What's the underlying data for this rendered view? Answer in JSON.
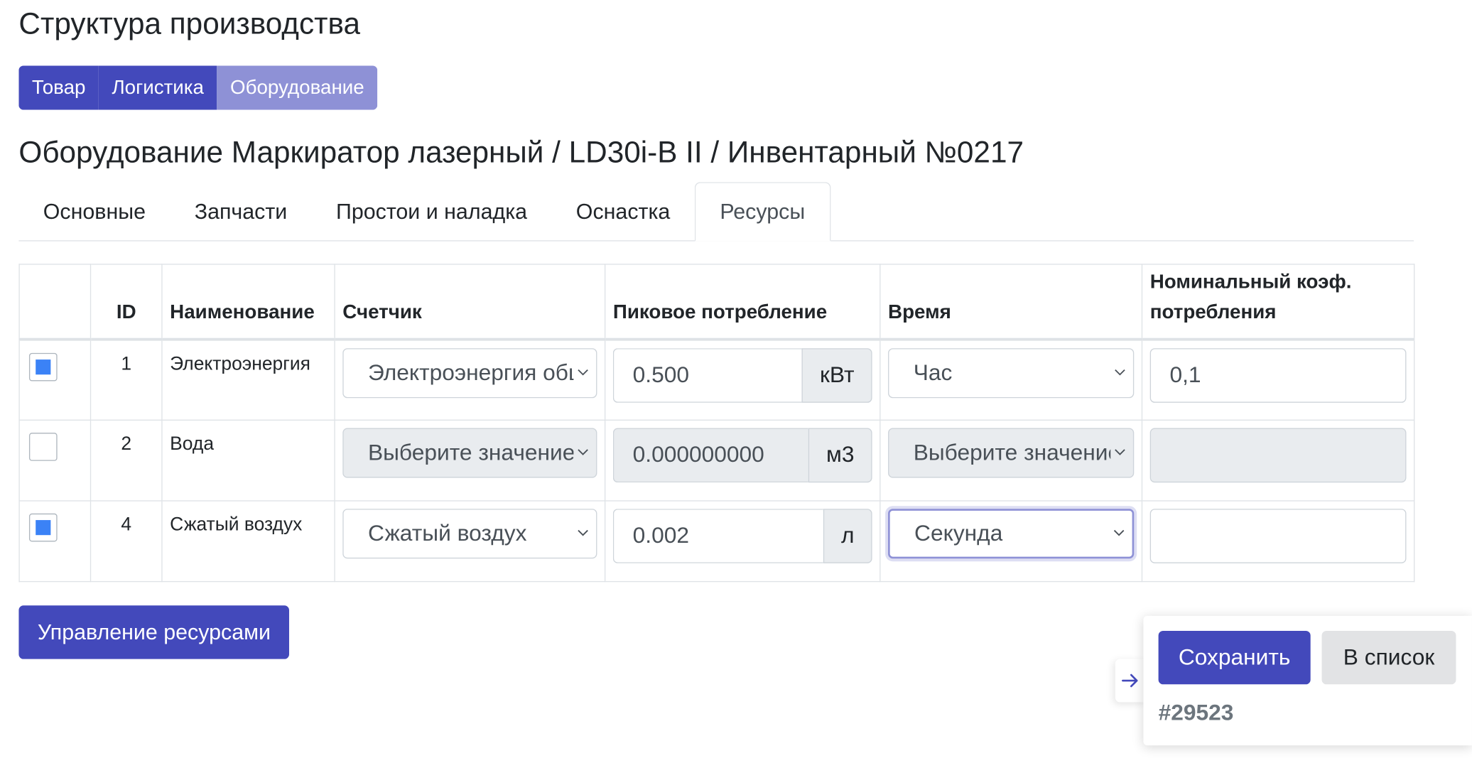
{
  "page_title": "Структура производства",
  "segments": [
    "Товар",
    "Логистика",
    "Оборудование"
  ],
  "equipment_title": "Оборудование Маркиратор лазерный / LD30i-B II / Инвентарный №0217",
  "tabs": [
    "Основные",
    "Запчасти",
    "Простои и наладка",
    "Оснастка",
    "Ресурсы"
  ],
  "active_tab": "Ресурсы",
  "table": {
    "headers": {
      "id": "ID",
      "name": "Наименование",
      "meter": "Счетчик",
      "peak": "Пиковое потребление",
      "time": "Время",
      "coef": "Номинальный коэф. потребления"
    },
    "rows": [
      {
        "checked": true,
        "id": "1",
        "name": "Электроэнергия",
        "meter": "Электроэнергия общая",
        "peak": "0.500",
        "unit": "кВт",
        "time": "Час",
        "coef": "0,1",
        "disabled": false
      },
      {
        "checked": false,
        "id": "2",
        "name": "Вода",
        "meter": "Выберите значение",
        "peak": "0.000000000",
        "unit": "м3",
        "time": "Выберите значение",
        "coef": "",
        "disabled": true
      },
      {
        "checked": true,
        "id": "4",
        "name": "Сжатый воздух",
        "meter": "Сжатый воздух",
        "peak": "0.002",
        "unit": "л",
        "time": "Секунда",
        "coef": "",
        "disabled": false
      }
    ]
  },
  "manage_button": "Управление ресурсами",
  "panel": {
    "save": "Сохранить",
    "to_list": "В список",
    "record_id": "#29523"
  },
  "colors": {
    "primary": "#4349bb",
    "segment_active": "#8e91d6",
    "checkbox": "#3b82f6"
  }
}
